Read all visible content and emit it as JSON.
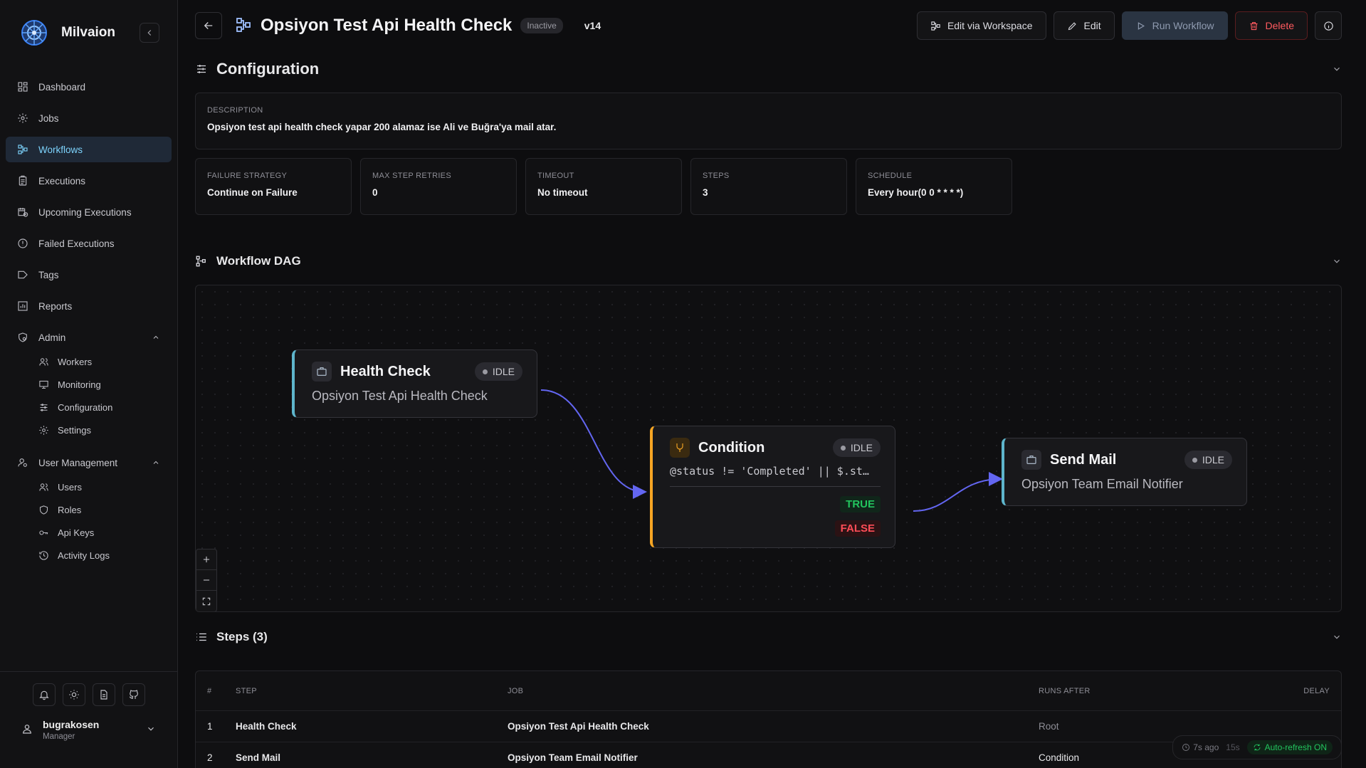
{
  "app": {
    "name": "Milvaion"
  },
  "sidebar": {
    "items": [
      {
        "label": "Dashboard",
        "icon": "dashboard-icon"
      },
      {
        "label": "Jobs",
        "icon": "gear-icon"
      },
      {
        "label": "Workflows",
        "icon": "workflow-icon",
        "active": true
      },
      {
        "label": "Executions",
        "icon": "clipboard-icon"
      },
      {
        "label": "Upcoming Executions",
        "icon": "calendar-clock-icon"
      },
      {
        "label": "Failed Executions",
        "icon": "alert-circle-icon"
      },
      {
        "label": "Tags",
        "icon": "tag-icon"
      },
      {
        "label": "Reports",
        "icon": "bar-chart-icon"
      }
    ],
    "admin": {
      "label": "Admin",
      "items": [
        {
          "label": "Workers",
          "icon": "users-icon"
        },
        {
          "label": "Monitoring",
          "icon": "monitor-icon"
        },
        {
          "label": "Configuration",
          "icon": "sliders-icon"
        },
        {
          "label": "Settings",
          "icon": "settings-icon"
        }
      ]
    },
    "user_management": {
      "label": "User Management",
      "items": [
        {
          "label": "Users",
          "icon": "users-icon"
        },
        {
          "label": "Roles",
          "icon": "shield-icon"
        },
        {
          "label": "Api Keys",
          "icon": "key-icon"
        },
        {
          "label": "Activity Logs",
          "icon": "history-icon"
        }
      ]
    },
    "user": {
      "name": "bugrakosen",
      "role": "Manager"
    }
  },
  "header": {
    "title": "Opsiyon Test Api Health Check",
    "status": "Inactive",
    "version": "v14",
    "actions": {
      "edit_workspace": "Edit via Workspace",
      "edit": "Edit",
      "run": "Run Workflow",
      "delete": "Delete"
    }
  },
  "configuration": {
    "title": "Configuration",
    "description_label": "Description",
    "description": "Opsiyon test api health check yapar 200 alamaz ise Ali ve Buğra'ya mail atar.",
    "stats": [
      {
        "label": "Failure Strategy",
        "value": "Continue on Failure"
      },
      {
        "label": "Max Step Retries",
        "value": "0"
      },
      {
        "label": "Timeout",
        "value": "No timeout"
      },
      {
        "label": "Steps",
        "value": "3"
      },
      {
        "label": "Schedule",
        "value": "Every hour(0 0 * * * *)"
      }
    ]
  },
  "dag": {
    "title": "Workflow DAG",
    "edge_color": "#6366f1",
    "nodes": {
      "health": {
        "title": "Health Check",
        "status": "IDLE",
        "subtitle": "Opsiyon Test Api Health Check"
      },
      "condition": {
        "title": "Condition",
        "status": "IDLE",
        "expression": "@status != 'Completed' || $.st…",
        "true_label": "TRUE",
        "false_label": "FALSE"
      },
      "mail": {
        "title": "Send Mail",
        "status": "IDLE",
        "subtitle": "Opsiyon Team Email Notifier"
      }
    }
  },
  "steps": {
    "title": "Steps (3)",
    "columns": [
      "#",
      "Step",
      "Job",
      "Runs After",
      "Delay"
    ],
    "rows": [
      {
        "num": "1",
        "step": "Health Check",
        "job": "Opsiyon Test Api Health Check",
        "after": "Root",
        "delay": ""
      },
      {
        "num": "2",
        "step": "Send Mail",
        "job": "Opsiyon Team Email Notifier",
        "after": "Condition",
        "delay": ""
      }
    ]
  },
  "refresh": {
    "ago": "7s ago",
    "interval": "15s",
    "auto": "Auto-refresh ON"
  }
}
